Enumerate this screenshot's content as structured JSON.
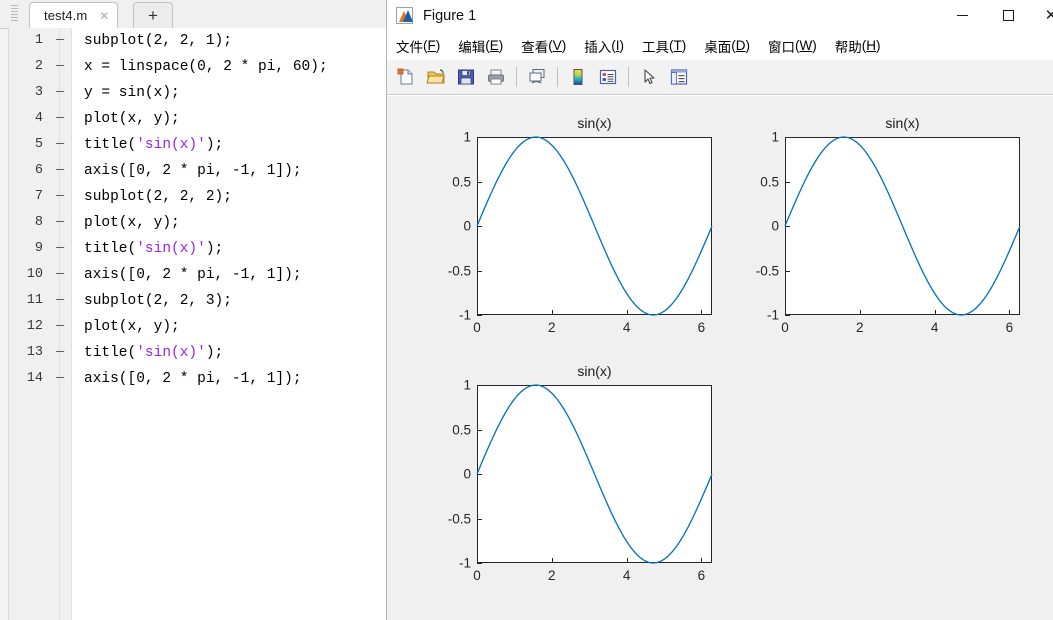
{
  "editor": {
    "tab": {
      "label": "test4.m",
      "close_icon": "close-icon",
      "new_tab_label": "+"
    },
    "lines": [
      {
        "n": "1",
        "dash": "—",
        "code": "subplot(2, 2, 1);"
      },
      {
        "n": "2",
        "dash": "—",
        "code": "x = linspace(0, 2 * pi, 60);"
      },
      {
        "n": "3",
        "dash": "—",
        "code": "y = sin(x);"
      },
      {
        "n": "4",
        "dash": "—",
        "code": "plot(x, y);"
      },
      {
        "n": "5",
        "dash": "—",
        "code": "title('sin(x)');",
        "str": "'sin(x)'",
        "pre": "title(",
        "post": ");"
      },
      {
        "n": "6",
        "dash": "—",
        "code": "axis([0, 2 * pi, -1, 1]);"
      },
      {
        "n": "7",
        "dash": "—",
        "code": "subplot(2, 2, 2);"
      },
      {
        "n": "8",
        "dash": "—",
        "code": "plot(x, y);"
      },
      {
        "n": "9",
        "dash": "—",
        "code": "title('sin(x)');",
        "str": "'sin(x)'",
        "pre": "title(",
        "post": ");"
      },
      {
        "n": "10",
        "dash": "—",
        "code": "axis([0, 2 * pi, -1, 1]);"
      },
      {
        "n": "11",
        "dash": "—",
        "code": "subplot(2, 2, 3);"
      },
      {
        "n": "12",
        "dash": "—",
        "code": "plot(x, y);"
      },
      {
        "n": "13",
        "dash": "—",
        "code": "title('sin(x)');",
        "str": "'sin(x)'",
        "pre": "title(",
        "post": ");"
      },
      {
        "n": "14",
        "dash": "—",
        "code": "axis([0, 2 * pi, -1, 1]);"
      }
    ]
  },
  "figure": {
    "title": "Figure 1",
    "app_icon": "matlab-figure-icon",
    "window_buttons": [
      {
        "name": "minimize-button",
        "glyph": "–"
      },
      {
        "name": "maximize-button",
        "glyph": "□"
      },
      {
        "name": "close-button",
        "glyph": "×"
      }
    ],
    "menu": [
      {
        "label": "文件",
        "key": "F"
      },
      {
        "label": "编辑",
        "key": "E"
      },
      {
        "label": "查看",
        "key": "V"
      },
      {
        "label": "插入",
        "key": "I"
      },
      {
        "label": "工具",
        "key": "T"
      },
      {
        "label": "桌面",
        "key": "D"
      },
      {
        "label": "窗口",
        "key": "W"
      },
      {
        "label": "帮助",
        "key": "H"
      }
    ],
    "toolbar": [
      {
        "name": "new-figure-icon"
      },
      {
        "name": "open-file-icon"
      },
      {
        "name": "save-figure-icon"
      },
      {
        "name": "print-figure-icon"
      },
      {
        "name": "separator"
      },
      {
        "name": "link-plot-icon"
      },
      {
        "name": "separator"
      },
      {
        "name": "colorbar-icon"
      },
      {
        "name": "legend-icon"
      },
      {
        "name": "separator"
      },
      {
        "name": "pointer-icon"
      },
      {
        "name": "plot-browser-icon"
      }
    ]
  },
  "chart_data": [
    {
      "id": "subplot-1",
      "position": "top-left",
      "type": "line",
      "title": "sin(x)",
      "xlabel": "",
      "ylabel": "",
      "xlim": [
        0,
        6.2832
      ],
      "ylim": [
        -1,
        1
      ],
      "xticks": [
        0,
        2,
        4,
        6
      ],
      "yticks": [
        -1,
        -0.5,
        0,
        0.5,
        1
      ],
      "xticklabels": [
        "0",
        "2",
        "4",
        "6"
      ],
      "yticklabels": [
        "-1",
        "-0.5",
        "0",
        "0.5",
        "1"
      ],
      "grid": false,
      "legend": null,
      "series": [
        {
          "name": "sin(x)",
          "color": "#0072BD",
          "n_points": 60,
          "x_expr": "linspace(0, 2*pi, 60)",
          "y_expr": "sin(x)"
        }
      ]
    },
    {
      "id": "subplot-2",
      "position": "top-right",
      "type": "line",
      "title": "sin(x)",
      "xlabel": "",
      "ylabel": "",
      "xlim": [
        0,
        6.2832
      ],
      "ylim": [
        -1,
        1
      ],
      "xticks": [
        0,
        2,
        4,
        6
      ],
      "yticks": [
        -1,
        -0.5,
        0,
        0.5,
        1
      ],
      "xticklabels": [
        "0",
        "2",
        "4",
        "6"
      ],
      "yticklabels": [
        "-1",
        "-0.5",
        "0",
        "0.5",
        "1"
      ],
      "grid": false,
      "legend": null,
      "series": [
        {
          "name": "sin(x)",
          "color": "#0072BD",
          "n_points": 60,
          "x_expr": "linspace(0, 2*pi, 60)",
          "y_expr": "sin(x)"
        }
      ]
    },
    {
      "id": "subplot-3",
      "position": "bottom-left",
      "type": "line",
      "title": "sin(x)",
      "xlabel": "",
      "ylabel": "",
      "xlim": [
        0,
        6.2832
      ],
      "ylim": [
        -1,
        1
      ],
      "xticks": [
        0,
        2,
        4,
        6
      ],
      "yticks": [
        -1,
        -0.5,
        0,
        0.5,
        1
      ],
      "xticklabels": [
        "0",
        "2",
        "4",
        "6"
      ],
      "yticklabels": [
        "-1",
        "-0.5",
        "0",
        "0.5",
        "1"
      ],
      "grid": false,
      "legend": null,
      "series": [
        {
          "name": "sin(x)",
          "color": "#0072BD",
          "n_points": 60,
          "x_expr": "linspace(0, 2*pi, 60)",
          "y_expr": "sin(x)"
        }
      ]
    }
  ],
  "colors": {
    "line": "#0072BD",
    "axis": "#262626",
    "figure_bg": "#F0F0F0",
    "axes_bg": "#FFFFFF",
    "string_token": "#A020F0"
  }
}
